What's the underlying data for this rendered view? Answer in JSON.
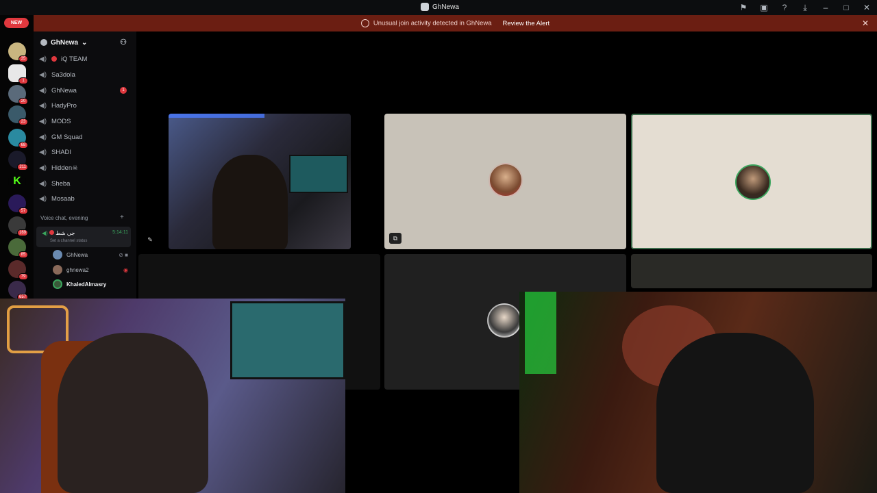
{
  "window": {
    "title": "GhNewa"
  },
  "alert": {
    "message": "Unusual join activity detected in GhNewa",
    "action": "Review the Alert"
  },
  "rail": {
    "new_label": "NEW",
    "servers": [
      {
        "name": "server-1",
        "badge": "35"
      },
      {
        "name": "server-pubg",
        "badge": "1"
      },
      {
        "name": "server-3",
        "badge": "20"
      },
      {
        "name": "server-4",
        "badge": "23"
      },
      {
        "name": "server-5",
        "badge": "68"
      },
      {
        "name": "server-st",
        "badge": "211"
      },
      {
        "name": "server-kick",
        "badge": ""
      },
      {
        "name": "server-8",
        "badge": "57"
      },
      {
        "name": "server-9",
        "badge": "169"
      },
      {
        "name": "server-10",
        "badge": "85"
      },
      {
        "name": "server-11",
        "badge": "79"
      },
      {
        "name": "server-12",
        "badge": "657"
      }
    ]
  },
  "sidebar": {
    "server_name": "GhNewa",
    "channels": [
      {
        "label": "iQ TEAM",
        "live": true,
        "mention": ""
      },
      {
        "label": "Sa3dola",
        "live": false,
        "mention": ""
      },
      {
        "label": "GhNewa",
        "live": false,
        "mention": "1"
      },
      {
        "label": "HadyPro",
        "live": false,
        "mention": ""
      },
      {
        "label": "MODS",
        "live": false,
        "mention": ""
      },
      {
        "label": "GM Squad",
        "live": false,
        "mention": ""
      },
      {
        "label": "SHADI",
        "live": false,
        "mention": ""
      },
      {
        "label": "Hidden☠",
        "live": false,
        "mention": ""
      },
      {
        "label": "Sheba",
        "live": false,
        "mention": ""
      },
      {
        "label": "Mosaab",
        "live": false,
        "mention": ""
      }
    ],
    "category": "Voice chat, evening",
    "active_channel": {
      "name": "جي شط",
      "timer": "5:14:11",
      "status": "Set a channel status"
    },
    "members": [
      {
        "name": "GhNewa"
      },
      {
        "name": "ghnewa2"
      },
      {
        "name": "KhaledAlmasry"
      }
    ]
  },
  "colors": {
    "accent_red": "#e0383e",
    "banner": "#6b1e12",
    "speaking_green": "#3ba55d"
  }
}
